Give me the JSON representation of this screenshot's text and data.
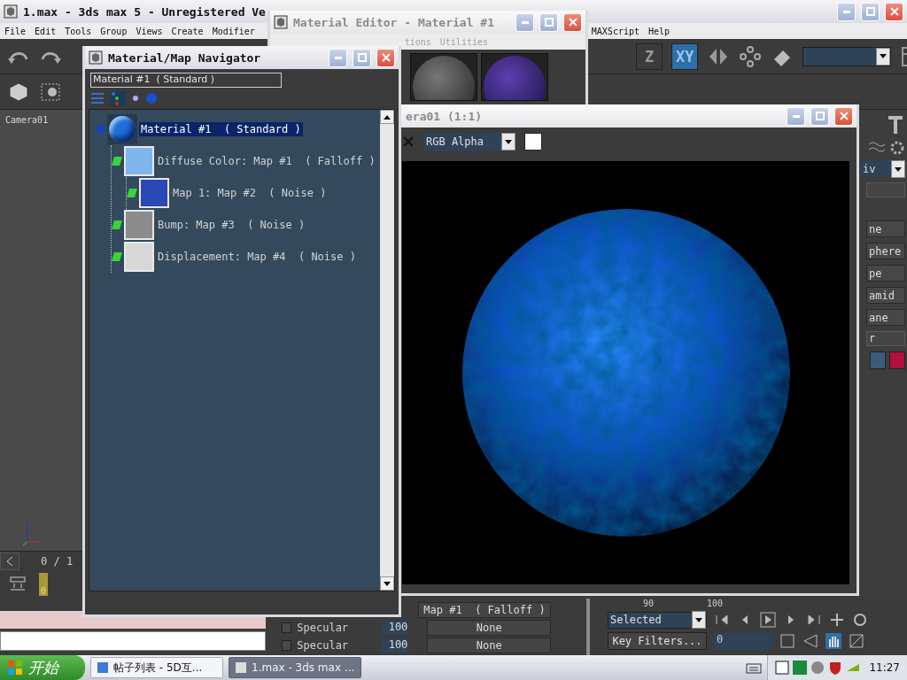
{
  "main_window": {
    "title": "1.max - 3ds max 5 - Unregistered Ve",
    "menu_left": [
      "File",
      "Edit",
      "Tools",
      "Group",
      "Views",
      "Create",
      "Modifier"
    ],
    "menu_right": [
      "MAXScript",
      "Help"
    ]
  },
  "toolbar": {
    "axis_buttons": [
      {
        "label": "Z",
        "selected": false
      },
      {
        "label": "XY",
        "selected": true
      }
    ]
  },
  "viewport": {
    "label": "Camera01",
    "time_reading": "0 / 1",
    "key_frame": "0"
  },
  "command_panel": {
    "dropdown": "iv",
    "buttons": [
      "ne",
      "phere",
      "pe",
      "amid",
      "ane"
    ],
    "field": "r"
  },
  "material_editor": {
    "title": "Material Editor - Material #1",
    "menu": [
      "tions",
      "Utilities"
    ]
  },
  "render_window": {
    "title": "era01 (1:1)",
    "channel": "RGB Alpha"
  },
  "navigator": {
    "title": "Material/Map Navigator",
    "field": "Material #1  ( Standard )",
    "tree": [
      {
        "label": "Material #1  ( Standard )",
        "kind": "material",
        "color": "#1f6fd8",
        "selected": true,
        "children": [
          {
            "label": "Diffuse Color: Map #1  ( Falloff )",
            "kind": "map",
            "color": "#7fb6f0",
            "selected": false,
            "children": [
              {
                "label": "Map 1: Map #2  ( Noise )",
                "kind": "map",
                "color": "#2a48b8",
                "selected": false
              }
            ]
          },
          {
            "label": "Bump: Map #3  ( Noise )",
            "kind": "map",
            "color": "#8c8c8c",
            "selected": false
          },
          {
            "label": "Displacement: Map #4  ( Noise )",
            "kind": "map",
            "color": "#d8d8d8",
            "selected": false
          }
        ]
      }
    ]
  },
  "material_params": {
    "rows": [
      {
        "map": "Map #1  ( Falloff )"
      },
      {
        "label": "Specular",
        "value": "100",
        "map": "None",
        "checked": false
      },
      {
        "label": "Specular",
        "value": "100",
        "map": "None",
        "checked": false
      }
    ]
  },
  "animation": {
    "ruler": [
      "90",
      "100"
    ],
    "key_mode": "Selected",
    "key_filters": "Key Filters...",
    "frame": "0"
  },
  "taskbar": {
    "start": "开始",
    "tasks": [
      {
        "label": "帖子列表 - 5D互...",
        "selected": false
      },
      {
        "label": "1.max - 3ds max ...",
        "selected": true
      }
    ],
    "clock": "11:27"
  }
}
